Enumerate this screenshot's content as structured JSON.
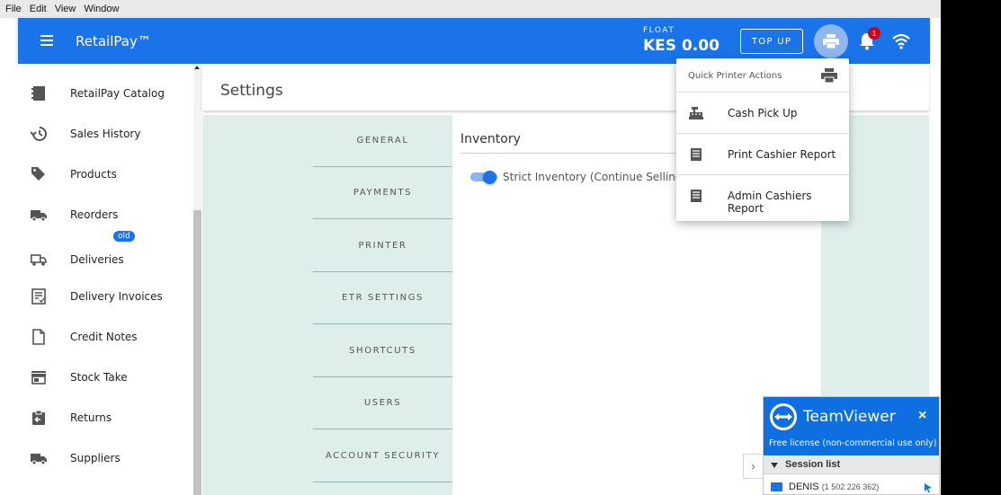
{
  "menubar": {
    "items": [
      "File",
      "Edit",
      "View",
      "Window"
    ]
  },
  "appbar": {
    "brand": "RetailPay™",
    "float_label": "FLOAT",
    "float_value": "KES 0.00",
    "topup_label": "TOP UP",
    "notification_count": "1",
    "accent_color": "#1a73e8"
  },
  "sidebar": {
    "items": [
      {
        "label": "RetailPay Catalog",
        "icon": "catalog-icon"
      },
      {
        "label": "Sales History",
        "icon": "history-icon"
      },
      {
        "label": "Products",
        "icon": "tag-icon"
      },
      {
        "label": "Reorders",
        "icon": "truck-icon"
      },
      {
        "label": "Deliveries",
        "icon": "delivery-truck-icon",
        "badge": "old"
      },
      {
        "label": "Delivery Invoices",
        "icon": "invoice-icon"
      },
      {
        "label": "Credit Notes",
        "icon": "note-icon"
      },
      {
        "label": "Stock Take",
        "icon": "store-icon"
      },
      {
        "label": "Returns",
        "icon": "returns-icon"
      },
      {
        "label": "Suppliers",
        "icon": "supplier-icon"
      }
    ]
  },
  "page": {
    "title": "Settings"
  },
  "settings": {
    "tabs": [
      "GENERAL",
      "PAYMENTS",
      "PRINTER",
      "ETR SETTINGS",
      "SHORTCUTS",
      "USERS",
      "ACCOUNT SECURITY"
    ],
    "panel_title": "Inventory",
    "toggle_label": "Strict Inventory (Continue Selling Eve",
    "toggle_on": true
  },
  "printer_menu": {
    "title": "Quick Printer Actions",
    "items": [
      "Cash Pick Up",
      "Print Cashier Report",
      "Admin Cashiers Report"
    ]
  },
  "teamviewer": {
    "name": "TeamViewer",
    "close": "×",
    "license": "Free license (non-commercial use only)",
    "session_list": "Session list",
    "session_name": "DENIS",
    "session_id": "(1 502 226 362)"
  }
}
